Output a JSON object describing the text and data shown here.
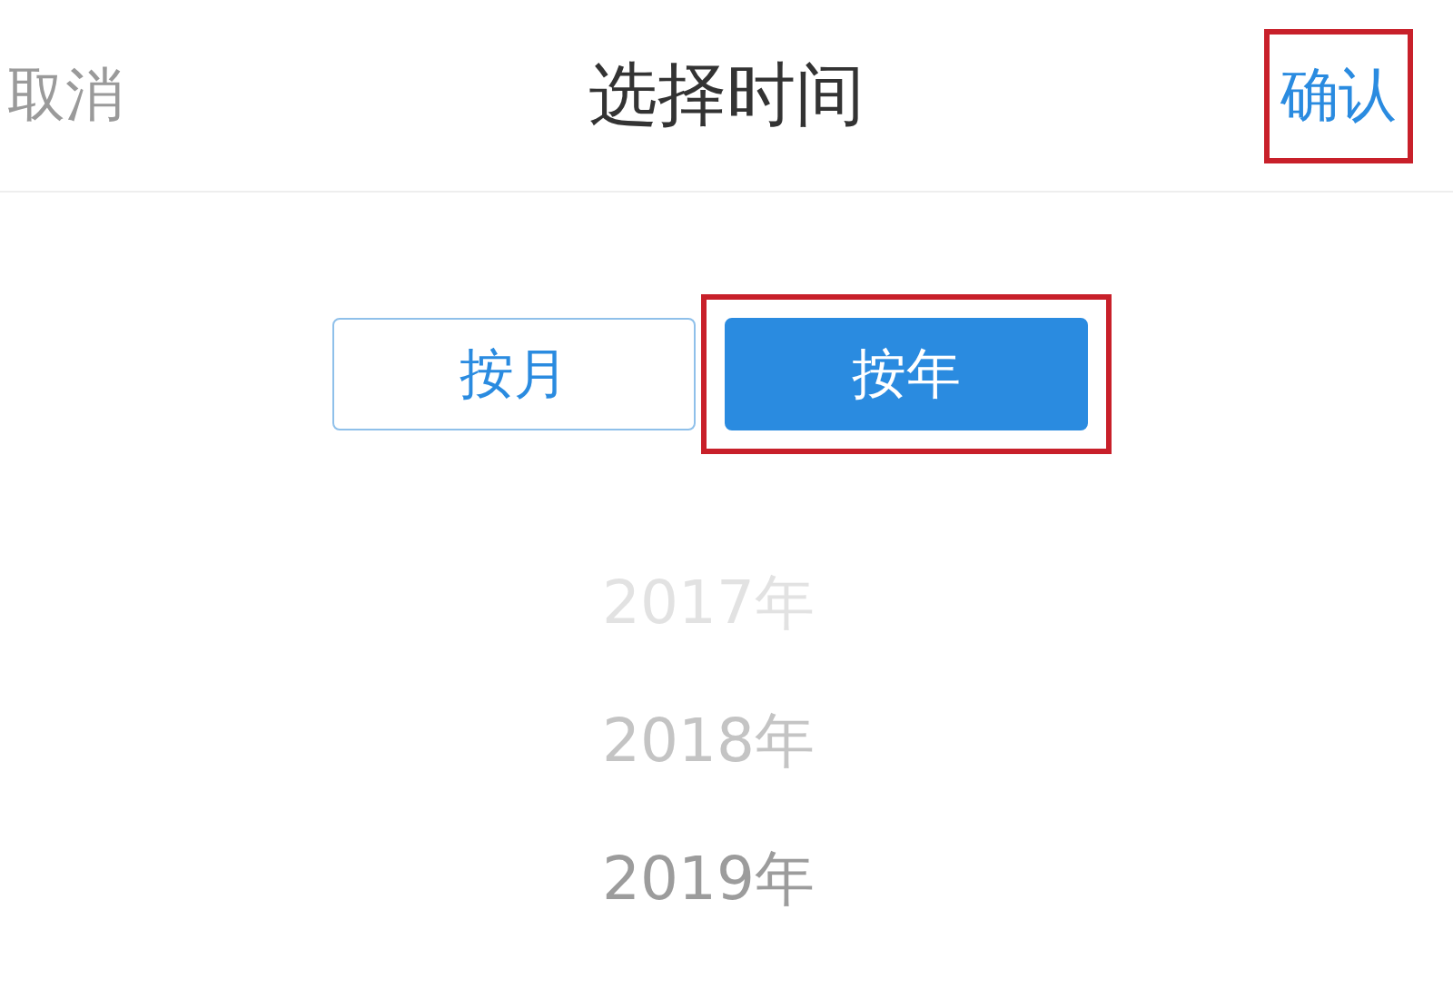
{
  "header": {
    "cancel": "取消",
    "title": "选择时间",
    "confirm": {
      "label": "确认",
      "highlighted": true
    }
  },
  "mode_tabs": [
    {
      "label": "按月",
      "selected": false,
      "highlighted": false
    },
    {
      "label": "按年",
      "selected": true,
      "highlighted": true
    }
  ],
  "years": [
    "2017年",
    "2018年",
    "2019年"
  ]
}
